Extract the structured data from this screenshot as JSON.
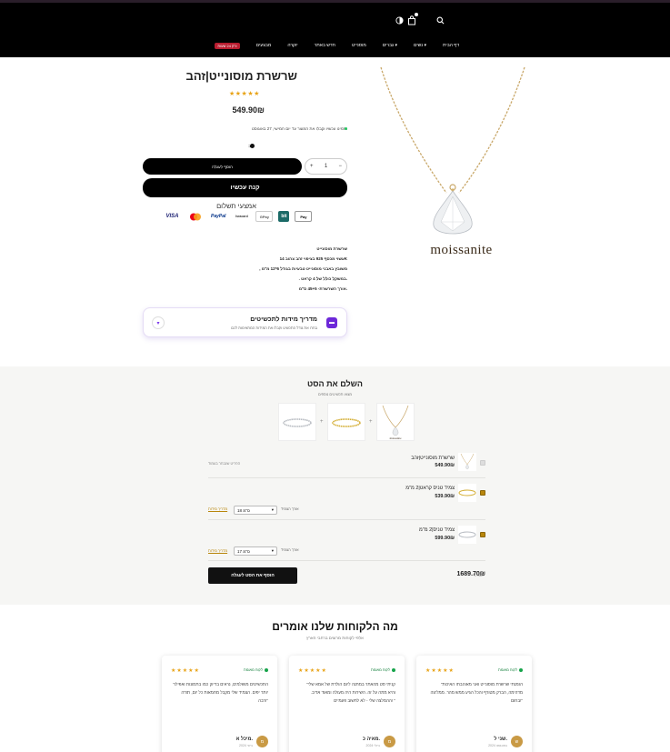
{
  "header": {
    "nav": [
      {
        "label": "דף הבית",
        "chevron": false
      },
      {
        "label": "נשים",
        "chevron": true
      },
      {
        "label": "גברים",
        "chevron": true
      },
      {
        "label": "מוסנייט",
        "chevron": false
      },
      {
        "label": "חדש באתר",
        "chevron": false
      },
      {
        "label": "יוקרה",
        "chevron": false
      },
      {
        "label": "מבצעים",
        "chevron": false
      }
    ],
    "sale_badge": "רק 24 שעות!",
    "icons": [
      "search-icon",
      "cart-icon",
      "theme-toggle-icon"
    ],
    "cart_count": ""
  },
  "product": {
    "title": "שרשרת מוסונייט|זהב",
    "stars": "★★★★★",
    "price": "549.90₪",
    "shipping_note": "הזמינו עכשיו וקבלו את המוצר עד יום חמישי, 27 באוגוסט",
    "color_label": "זהב",
    "add_to_cart": "הוסף לעגלה",
    "quantity": "1",
    "qty_minus": "−",
    "qty_plus": "+",
    "buy_now": "קנה עכשיו",
    "payment_title": "אמצעי תשלום",
    "payment_methods": [
      "VISA",
      "Mastercard",
      "PayPal",
      "Isracard",
      "GPay",
      "bit",
      "Pay"
    ],
    "image_word": "moissanite",
    "description": [
      "שרשרת מוסונייט",
      "עשוי מכסף 925 בציפוי זהב צהוב 14K",
      ", משובץ באבני מוסונייט טבעיות בגודל 6*12 מ\"מ",
      ". במשקל כולל של 4 קראט.",
      "אורך השרשרת- 45+5 ס\"מ."
    ]
  },
  "size_guide": {
    "title": "מדריך מידות לתכשיטים",
    "subtitle": "בחרו את גודל התכשיט וקבלו את המידות המתאימות לכם"
  },
  "complete_set": {
    "title": "השלם את הסט",
    "subtitle": "מצאו תכשיטים נוספים",
    "rows": [
      {
        "name": "שרשרת מוסונייט|זהב",
        "price": "549.90₪",
        "checked": false,
        "note": "הפריט שנבחר בעמוד",
        "size_label": "",
        "size_value": "",
        "link": ""
      },
      {
        "name": "צמיד טניס קראט|2 מ\"מ",
        "price": "539.90₪",
        "checked": true,
        "note": "",
        "size_label": "אורך הצמיד",
        "size_value": "18 ס\"מ",
        "link": "מדריך מידות"
      },
      {
        "name": "צמיד טניס|2 מ\"מ",
        "price": "599.90₪",
        "checked": true,
        "note": "",
        "size_label": "אורך הצמיד",
        "size_value": "17 ס\"מ",
        "link": "מדריך מידות"
      }
    ],
    "total_label": "סה\"כ:",
    "total": "1689.70₪",
    "button": "הוסף את הסט לעגלה"
  },
  "testimonials": {
    "title": "מה הלקוחות שלנו אומרים",
    "subtitle": "אלפי לקוחות מרוצים ברחבי הארץ",
    "verified_label": "לקוח מאומת",
    "cards": [
      {
        "text": "\"הזמנתי שרשרת מוסונייט ואני מאוהבת! האיכות מדהימה, הברק מטורף והכל הגיע ממש מהר. ממליצה בחום!\"",
        "name": "שני ל.",
        "date": "2024 באוגוסט",
        "initial": "ש",
        "stars": "★★★★★"
      },
      {
        "text": "\"קניתי סט מהאתר במתנה ליום הולדת של אמא שלי והיא מתה על זה. השירות היה מעולה ומאוד אדיב. ההמלצה שלי - לא לחשוב פעמיים! \"",
        "name": "מאיה כ.",
        "date": "2024 ביולי",
        "initial": "מ",
        "stars": "★★★★★"
      },
      {
        "text": "\"התכשיטים מושלמים, נראים בדיוק כמו בתמונות ואפילו יותר יפים. הצמיד שלי מקבל מחמאות כל יום, תודה רבה!\"",
        "name": "מיכל א.",
        "date": "2024 ביוני",
        "initial": "מ",
        "stars": "★★★★★"
      }
    ]
  }
}
